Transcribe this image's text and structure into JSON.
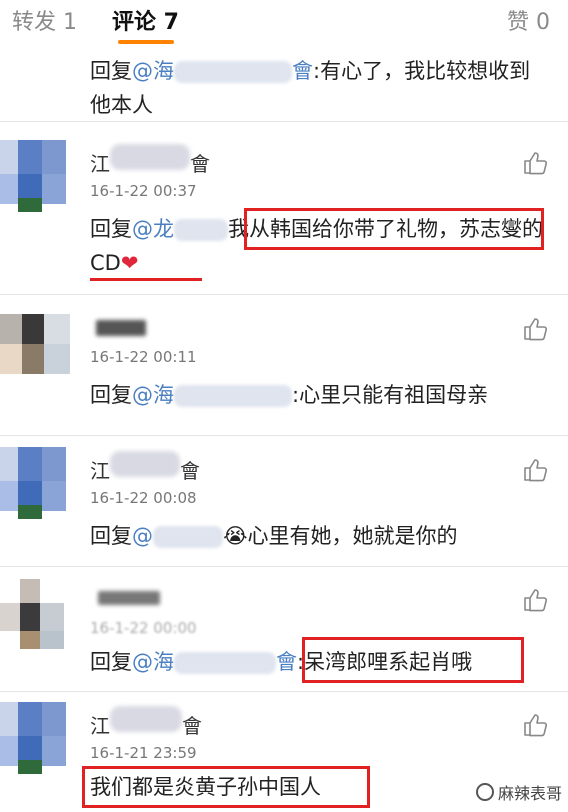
{
  "tabs": {
    "repost": "转发 1",
    "comments": "评论 7",
    "likes": "赞 0"
  },
  "comments": [
    {
      "reply_prefix": "回复",
      "mention": "@海",
      "mention_tail": "會",
      "text": ":有心了，我比较想收到他本人"
    },
    {
      "username": "江",
      "username_tail": "會",
      "time": "16-1-22 00:37",
      "reply_prefix": "回复",
      "mention": "@龙",
      "text": "我从韩国给你带了礼物，苏志燮的CD",
      "heart": "❤"
    },
    {
      "username": "",
      "time": "16-1-22 00:11",
      "reply_prefix": "回复",
      "mention": "@海",
      "text": ":心里只能有祖国母亲"
    },
    {
      "username": "江",
      "username_tail": "會",
      "time": "16-1-22 00:08",
      "reply_prefix": "回复",
      "mention": "@",
      "emoji": "😭",
      "text": "心里有她，她就是你的"
    },
    {
      "username": "",
      "time": "16-1-22 00:00",
      "reply_prefix": "回复",
      "mention": "@海",
      "mention_tail": "會",
      "text": ":呆湾郎哩系起肖哦"
    },
    {
      "username": "江",
      "username_tail": "會",
      "time": "16-1-21 23:59",
      "text": "我们都是炎黄子孙中国人"
    }
  ],
  "watermark": "麻辣表哥",
  "colors": {
    "accent_orange": "#ff8200",
    "mention_blue": "#4a7fc1",
    "highlight_red": "#e02222"
  }
}
